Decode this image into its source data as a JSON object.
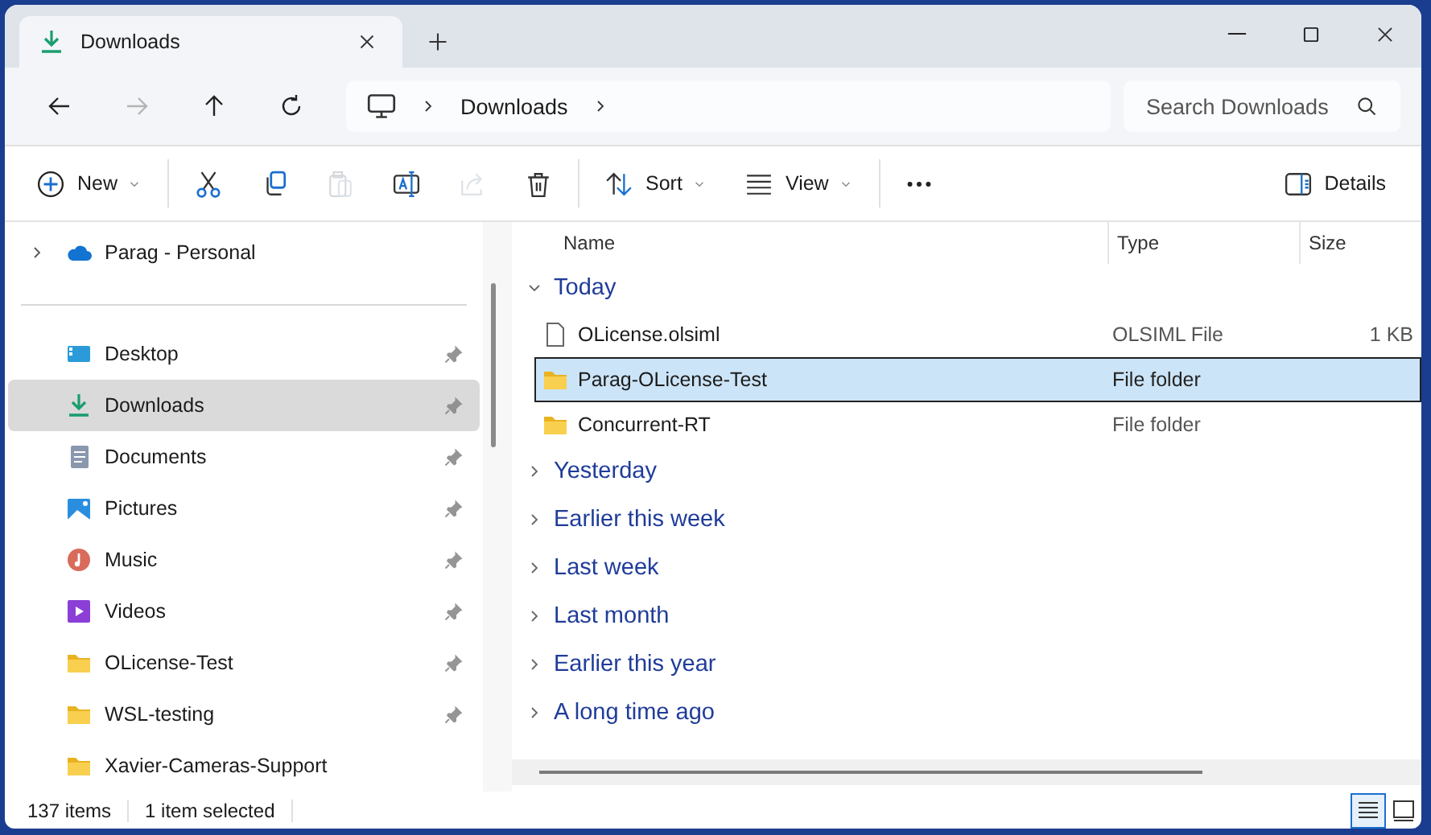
{
  "tabs": [
    {
      "title": "Downloads",
      "selected": true
    }
  ],
  "nav": {
    "back": {
      "disabled": false
    },
    "forward": {
      "disabled": true
    },
    "up": {
      "disabled": false
    },
    "refresh": {
      "disabled": false
    },
    "breadcrumb": [
      "Downloads"
    ],
    "search": {
      "placeholder": "Search Downloads"
    }
  },
  "toolbar": [
    {
      "kind": "new",
      "label": "New",
      "dropdown": true,
      "disabled": false
    },
    {
      "kind": "cut",
      "disabled": false
    },
    {
      "kind": "copy",
      "disabled": false
    },
    {
      "kind": "paste",
      "disabled": true
    },
    {
      "kind": "rename",
      "disabled": false
    },
    {
      "kind": "share",
      "disabled": true
    },
    {
      "kind": "delete",
      "disabled": false
    },
    {
      "kind": "sort",
      "label": "Sort",
      "dropdown": true,
      "disabled": false
    },
    {
      "kind": "view",
      "label": "View",
      "dropdown": true,
      "disabled": false
    },
    {
      "kind": "more",
      "disabled": false
    },
    {
      "kind": "details",
      "label": "Details",
      "disabled": false
    }
  ],
  "sidebar": {
    "items": [
      {
        "label": "Parag - Personal",
        "kind": "cloud",
        "expanded": false,
        "pinned": false,
        "selected": false
      },
      {
        "label": "Desktop",
        "kind": "desktop",
        "pinned": true,
        "selected": false
      },
      {
        "label": "Downloads",
        "kind": "download",
        "pinned": true,
        "selected": true
      },
      {
        "label": "Documents",
        "kind": "documents",
        "pinned": true,
        "selected": false
      },
      {
        "label": "Pictures",
        "kind": "pictures",
        "pinned": true,
        "selected": false
      },
      {
        "label": "Music",
        "kind": "music",
        "pinned": true,
        "selected": false
      },
      {
        "label": "Videos",
        "kind": "videos",
        "pinned": true,
        "selected": false
      },
      {
        "label": "OLicense-Test",
        "kind": "folder",
        "pinned": true,
        "selected": false
      },
      {
        "label": "WSL-testing",
        "kind": "folder",
        "pinned": true,
        "selected": false
      },
      {
        "label": "Xavier-Cameras-Support",
        "kind": "folder",
        "pinned": false,
        "selected": false
      }
    ]
  },
  "files": {
    "columns": [
      "Name",
      "Type",
      "Size"
    ],
    "groups": [
      {
        "label": "Today",
        "expanded": true,
        "rows": [
          {
            "name": "OLicense.olsiml",
            "type": "OLSIML File",
            "size": "1 KB",
            "kind": "file",
            "selected": false
          },
          {
            "name": "Parag-OLicense-Test",
            "type": "File folder",
            "kind": "folder",
            "selected": true
          },
          {
            "name": "Concurrent-RT",
            "type": "File folder",
            "kind": "folder",
            "selected": false
          }
        ]
      },
      {
        "label": "Yesterday",
        "expanded": false
      },
      {
        "label": "Earlier this week",
        "expanded": false
      },
      {
        "label": "Last week",
        "expanded": false
      },
      {
        "label": "Last month",
        "expanded": false
      },
      {
        "label": "Earlier this year",
        "expanded": false
      },
      {
        "label": "A long time ago",
        "expanded": false
      }
    ]
  },
  "status_bar": {
    "items": [
      "137 items",
      "1 item selected"
    ],
    "views": [
      {
        "kind": "details",
        "selected": true
      },
      {
        "kind": "tiles",
        "selected": false
      }
    ]
  }
}
